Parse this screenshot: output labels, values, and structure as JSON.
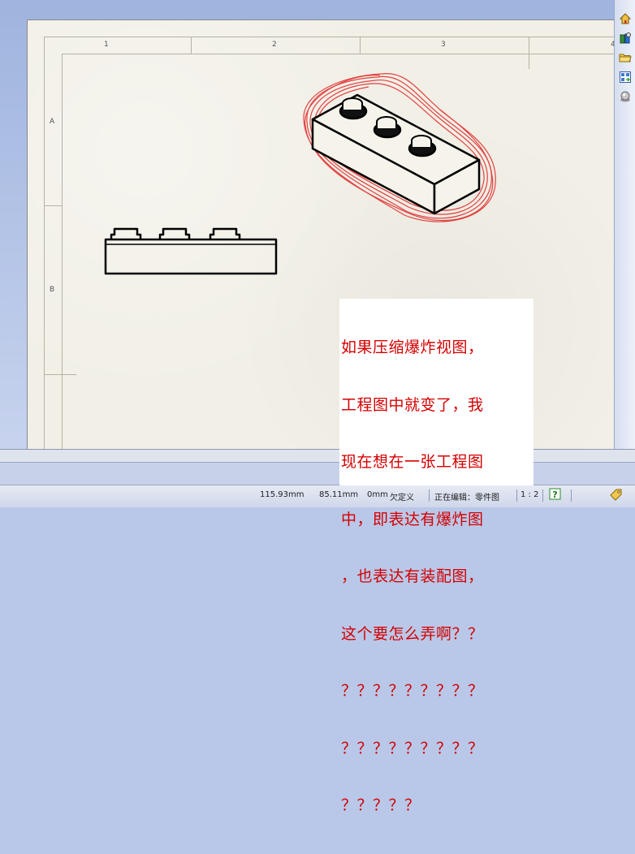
{
  "sheet": {
    "column_labels": [
      "1",
      "2",
      "3",
      "4"
    ],
    "row_labels": [
      "A",
      "B"
    ]
  },
  "annotation": {
    "lines": [
      "如果压缩爆炸视图，",
      "工程图中就变了，我",
      "现在想在一张工程图",
      "中，即表达有爆炸图",
      "，也表达有装配图，",
      "这个要怎么弄啊？？",
      "？？？？？？？？？",
      "？？？？？？？？？",
      "？？？？？"
    ],
    "color": "#d40000"
  },
  "right_toolbar": {
    "icons": [
      "home-icon",
      "design-library-icon",
      "open-folder-icon",
      "view-palette-icon",
      "appearance-icon"
    ]
  },
  "statusbar": {
    "x_coord": "115.93mm",
    "y_coord": "85.11mm",
    "z_coord": "0mm",
    "definition_state": "欠定义",
    "editing_label": "正在编辑：零件图",
    "scale": "1 : 2"
  },
  "colors": {
    "sheet_bg": "#f1efe6",
    "highlight_scribble": "#e03030"
  }
}
